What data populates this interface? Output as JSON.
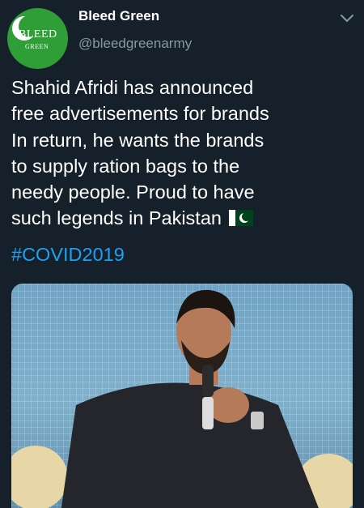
{
  "account": {
    "display_name": "Bleed Green",
    "handle": "@bleedgreenarmy",
    "avatar_logo_top": "BLEED",
    "avatar_logo_bottom": "GREEN"
  },
  "tweet": {
    "text": "Shahid Afridi has announced\nfree advertisements for brands\nIn return, he wants the brands\nto supply ration bags to the\nneedy people. Proud to have\nsuch legends in Pakistan",
    "emoji": "pakistan-flag",
    "hashtag": "#COVID2019"
  },
  "icons": {
    "menu": "chevron-down-icon",
    "flag": "pakistan-flag-icon"
  },
  "colors": {
    "background": "#15202b",
    "text_primary": "#ffffff",
    "text_secondary": "#8899a6",
    "link": "#1da1f2",
    "brand_green": "#2f9e37"
  }
}
